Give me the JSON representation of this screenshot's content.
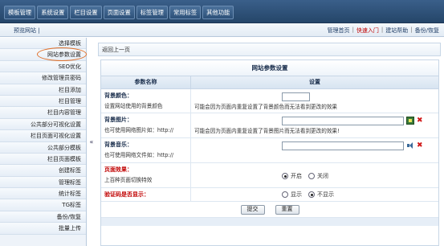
{
  "topnav": [
    "模板管理",
    "系统设置",
    "栏目设置",
    "页面设置",
    "标签管理",
    "常用标签",
    "其他功能"
  ],
  "subbar": {
    "preview": "预览网站 |",
    "links": [
      {
        "label": "管理首页",
        "hot": false
      },
      {
        "label": "快速入门",
        "hot": true
      },
      {
        "label": "建站帮助",
        "hot": false
      },
      {
        "label": "备份/恢复",
        "hot": false
      }
    ]
  },
  "sidebar": {
    "items": [
      "选择模板",
      "网站参数设置",
      "SEO优化",
      "修改管理员密码",
      "栏目添加",
      "栏目管理",
      "栏目内容管理",
      "公共部分可视化设置",
      "栏目页面可视化设置",
      "公共部分模板",
      "栏目页面模板",
      "创建标签",
      "管理标签",
      "统计标签",
      "TG标签",
      "备份/恢复",
      "批量上传"
    ],
    "active_index": 1,
    "collapse_glyph": "«"
  },
  "main": {
    "back": "返回上一页",
    "title": "网站参数设置",
    "col_name": "参数名称",
    "col_setting": "设置",
    "rows": {
      "bgcolor": {
        "label": "背景颜色：",
        "desc": "设置网站使用的背景颜色",
        "note": "可能会因为页面内重复设置了背景颜色而无法看到更改的效果",
        "value": ""
      },
      "bgimage": {
        "label": "背景图片：",
        "desc": "也可使用网络图片如：http://",
        "note": "可能会因为页面内重复设置了背景图片而无法看到更改的效果!",
        "value": ""
      },
      "bgmusic": {
        "label": "背景音乐：",
        "desc": "也可使用网络文件如：http://",
        "value": ""
      },
      "effect": {
        "label": "页面效果：",
        "desc": "上百种页面切换特效",
        "opt_on": "开启",
        "opt_off": "关闭",
        "selected": "on"
      },
      "captcha": {
        "label": "验证码是否显示：",
        "opt_show": "显示",
        "opt_hide": "不显示",
        "selected": "hide"
      }
    },
    "submit": "提交",
    "reset": "重置"
  }
}
